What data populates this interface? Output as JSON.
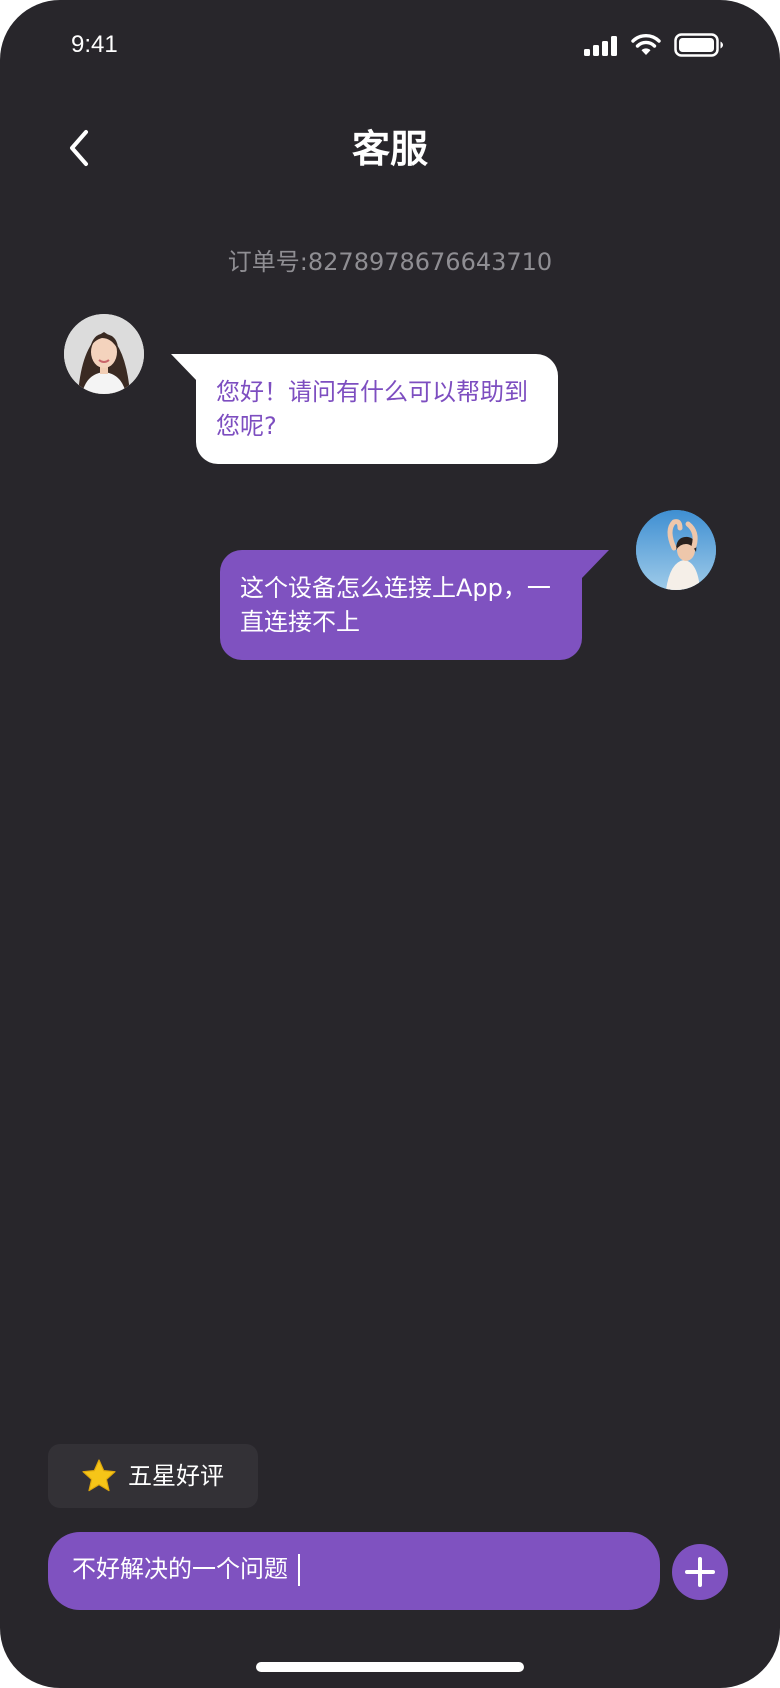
{
  "status_bar": {
    "time": "9:41",
    "icons": [
      "cellular-signal-icon",
      "wifi-icon",
      "battery-icon"
    ]
  },
  "header": {
    "title": "客服",
    "back_icon": "chevron-left-icon"
  },
  "order": {
    "text": "订单号:8278978676643710"
  },
  "messages": [
    {
      "sender": "agent",
      "text": "您好！请问有什么可以帮助到您呢?"
    },
    {
      "sender": "user",
      "text": "这个设备怎么连接上App，一直连接不上"
    }
  ],
  "quick_reply": {
    "label": "五星好评",
    "icon": "star-icon"
  },
  "composer": {
    "value": "不好解决的一个问题",
    "add_icon": "plus-icon"
  },
  "colors": {
    "background": "#28262b",
    "accent": "#7f52c0",
    "agent_bubble": "#ffffff",
    "agent_text": "#7d4ec0",
    "muted_text": "#8f8e93",
    "star": "#f6c518"
  }
}
